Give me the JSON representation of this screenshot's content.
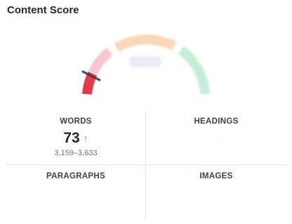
{
  "panel": {
    "title": "Content Score"
  },
  "gauge": {
    "colors": {
      "low": "#e8394a",
      "low_light": "#f8c7cc",
      "mid": "#fbd7b6",
      "high": "#c5edd6"
    }
  },
  "stats": {
    "words": {
      "label": "WORDS",
      "value": "73",
      "trend_icon": "arrow-up-icon",
      "range": "3,159–3,633"
    },
    "headings": {
      "label": "HEADINGS"
    },
    "paragraphs": {
      "label": "PARAGRAPHS"
    },
    "images": {
      "label": "IMAGES"
    }
  }
}
